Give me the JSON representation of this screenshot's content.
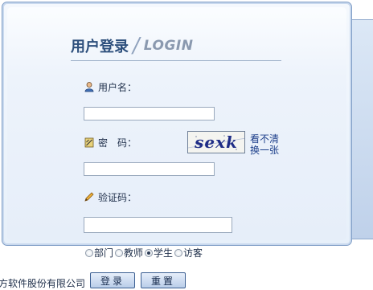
{
  "header": {
    "title_cn": "用户登录",
    "separator": "/",
    "title_en": "LOGIN"
  },
  "form": {
    "username": {
      "label": "用户名：",
      "value": ""
    },
    "password": {
      "label": "密　码：",
      "value": ""
    },
    "captcha": {
      "image_text": "sexk",
      "refresh_line1": "看不清",
      "refresh_line2": "换一张"
    },
    "verify": {
      "label": "验证码：",
      "value": ""
    }
  },
  "roles": [
    {
      "label": "部门",
      "checked": false
    },
    {
      "label": "教师",
      "checked": false
    },
    {
      "label": "学生",
      "checked": true
    },
    {
      "label": "访客",
      "checked": false
    }
  ],
  "footer": {
    "company": "方软件股份有限公司"
  },
  "buttons": {
    "login": "登录",
    "reset": "重置"
  },
  "colors": {
    "title": "#2d4f7c",
    "panel_border": "#7f9dc6",
    "link": "#1d3f8a",
    "captcha_text": "#1e2c86"
  }
}
